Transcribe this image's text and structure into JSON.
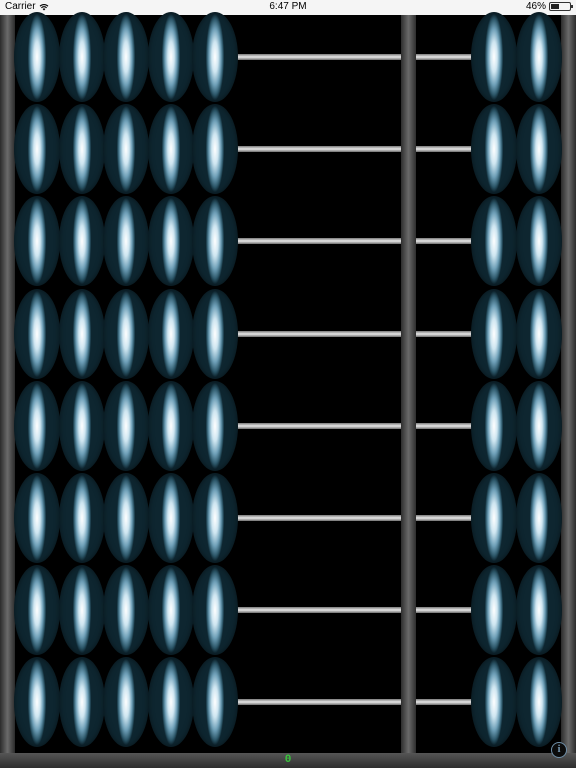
{
  "status_bar": {
    "carrier": "Carrier",
    "time": "6:47 PM",
    "battery_percent": "46%",
    "battery_level": 0.46
  },
  "abacus": {
    "rods": 8,
    "upper_deck_beads_per_rod": 5,
    "lower_deck_beads_per_rod": 2,
    "bead_color": "#6fa0b8"
  },
  "total": {
    "value": "0"
  },
  "info_button": {
    "label": "i"
  }
}
